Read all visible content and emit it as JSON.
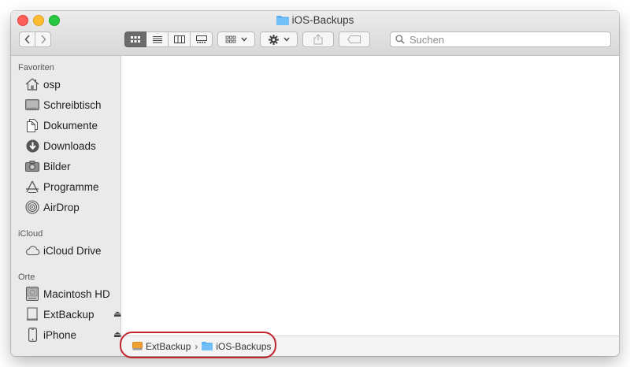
{
  "window": {
    "title": "iOS-Backups"
  },
  "search": {
    "placeholder": "Suchen"
  },
  "sidebar": {
    "favorites_header": "Favoriten",
    "favorites": [
      {
        "label": "osp",
        "icon": "home-icon"
      },
      {
        "label": "Schreibtisch",
        "icon": "desktop-icon"
      },
      {
        "label": "Dokumente",
        "icon": "documents-icon"
      },
      {
        "label": "Downloads",
        "icon": "downloads-icon"
      },
      {
        "label": "Bilder",
        "icon": "camera-icon"
      },
      {
        "label": "Programme",
        "icon": "applications-icon"
      },
      {
        "label": "AirDrop",
        "icon": "airdrop-icon"
      }
    ],
    "icloud_header": "iCloud",
    "icloud": [
      {
        "label": "iCloud Drive",
        "icon": "cloud-icon"
      }
    ],
    "locations_header": "Orte",
    "locations": [
      {
        "label": "Macintosh HD",
        "icon": "hard-disk-icon"
      },
      {
        "label": "ExtBackup",
        "icon": "external-drive-icon",
        "eject": "⏏"
      },
      {
        "label": "iPhone",
        "icon": "iphone-icon",
        "eject": "⏏"
      }
    ]
  },
  "pathbar": {
    "items": [
      {
        "label": "ExtBackup",
        "icon": "external-drive-icon"
      },
      {
        "label": "iOS-Backups",
        "icon": "folder-icon"
      }
    ],
    "separator": "›"
  },
  "colors": {
    "folder": "#5ab0f0",
    "highlight": "#c0262d",
    "drive": "#f0a030"
  }
}
